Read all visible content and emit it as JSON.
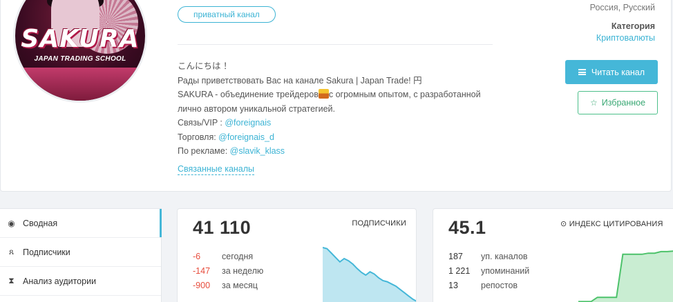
{
  "channel": {
    "avatar_logo": "SAKURA",
    "avatar_sub": "JAPAN TRADING SCHOOL",
    "private_label": "приватный канал",
    "description": [
      {
        "parts": [
          {
            "text": "こんにちは ！"
          }
        ]
      },
      {
        "parts": [
          {
            "text": "Рады приветствовать Вас на канале Sakura | Japan Trade! 円"
          }
        ]
      },
      {
        "parts": [
          {
            "text": "SAKURA - объединение трейдеров"
          },
          {
            "emoji": true
          },
          {
            "text": "с огромным опытом, с разработанной"
          }
        ]
      },
      {
        "parts": [
          {
            "text": "лично автором уникальной стратегией."
          }
        ]
      },
      {
        "parts": [
          {
            "text": "Связь/VIP : "
          },
          {
            "link": "@foreignais"
          }
        ]
      },
      {
        "parts": [
          {
            "text": "Торговля: "
          },
          {
            "link": "@foreignais_d"
          }
        ]
      },
      {
        "parts": [
          {
            "text": "По рекламе: "
          },
          {
            "link": "@slavik_klass"
          }
        ]
      }
    ],
    "related_link": "Связанные каналы"
  },
  "meta": {
    "country_language": "Россия, Русский",
    "category_title": "Категория",
    "category_value": "Криптовалюты"
  },
  "actions": {
    "read_label": "Читать канал",
    "favorite_label": "Избранное"
  },
  "sidebar": {
    "items": [
      {
        "label": "Сводная",
        "icon": "dashboard-icon",
        "active": true
      },
      {
        "label": "Подписчики",
        "icon": "users-icon",
        "active": false
      },
      {
        "label": "Анализ аудитории",
        "icon": "hourglass-icon",
        "active": false
      }
    ]
  },
  "subscribers_card": {
    "value": "41 110",
    "label": "ПОДПИСЧИКИ",
    "rows": [
      {
        "num": "-6",
        "label": "сегодня"
      },
      {
        "num": "-147",
        "label": "за неделю"
      },
      {
        "num": "-900",
        "label": "за месяц"
      }
    ],
    "spark": [
      1.0,
      0.98,
      0.9,
      0.82,
      0.74,
      0.8,
      0.76,
      0.7,
      0.62,
      0.55,
      0.5,
      0.56,
      0.52,
      0.45,
      0.4,
      0.38,
      0.34,
      0.3,
      0.24,
      0.18,
      0.12,
      0.06,
      0.02
    ],
    "color": "#45b7d8"
  },
  "citation_card": {
    "value": "45.1",
    "label": "ИНДЕКС ЦИТИРОВАНИЯ",
    "rows": [
      {
        "num": "187",
        "label": "уп. каналов"
      },
      {
        "num": "1 221",
        "label": "упоминаний"
      },
      {
        "num": "13",
        "label": "репостов"
      }
    ],
    "spark": [
      0.02,
      0.02,
      0.02,
      0.1,
      0.1,
      0.1,
      0.1,
      0.9,
      0.9,
      0.9,
      0.9,
      0.92,
      0.92,
      0.95,
      0.95,
      0.96
    ],
    "color": "#4cc26a"
  }
}
